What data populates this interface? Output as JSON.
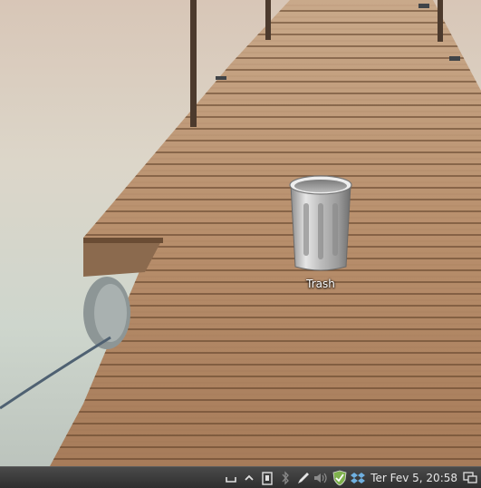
{
  "desktop": {
    "icons": [
      {
        "label": "Trash",
        "icon": "trash-icon"
      }
    ]
  },
  "taskbar": {
    "tray_icons": [
      "eject-icon",
      "chevron-up-icon",
      "clipboard-icon",
      "bluetooth-icon",
      "pen-icon",
      "volume-icon",
      "shield-check-icon",
      "dropbox-icon"
    ],
    "clock": "Ter Fev  5, 20:58",
    "show_desktop_icon": "show-desktop-icon"
  }
}
